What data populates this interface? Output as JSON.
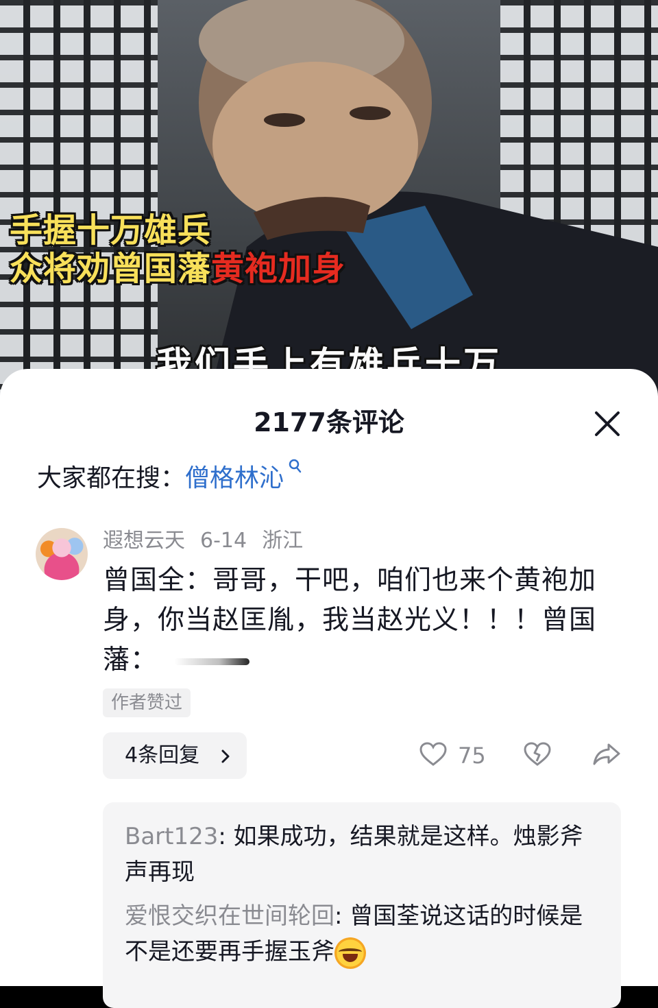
{
  "video": {
    "caption_line1": "手握十万雄兵",
    "caption_line2_yellow": "众将劝曾国藩",
    "caption_line2_red": "黄袍加身",
    "subtitle": "我们手上有雄兵十万"
  },
  "comments_panel": {
    "title": "2177条评论",
    "search_prefix": "大家都在搜：",
    "search_keyword": "僧格林沁"
  },
  "comment": {
    "username": "遐想云天",
    "date": "6-14",
    "location": "浙江",
    "text": "曾国全：哥哥，干吧，咱们也来个黄袍加身，你当赵匡胤，我当赵光义！！！曾国藩：",
    "author_liked": "作者赞过",
    "reply_count_label": "4条回复",
    "like_count": "75"
  },
  "replies": [
    {
      "name": "Bart123",
      "text": "如果成功，结果就是这样。烛影斧声再现"
    },
    {
      "name": "爱恨交织在世间轮回",
      "text": "曾国荃说这话的时候是不是还要再手握玉斧"
    }
  ],
  "colors": {
    "accent_link": "#2f6fcc",
    "caption_yellow": "#f8e05a",
    "caption_red": "#e52b20"
  }
}
